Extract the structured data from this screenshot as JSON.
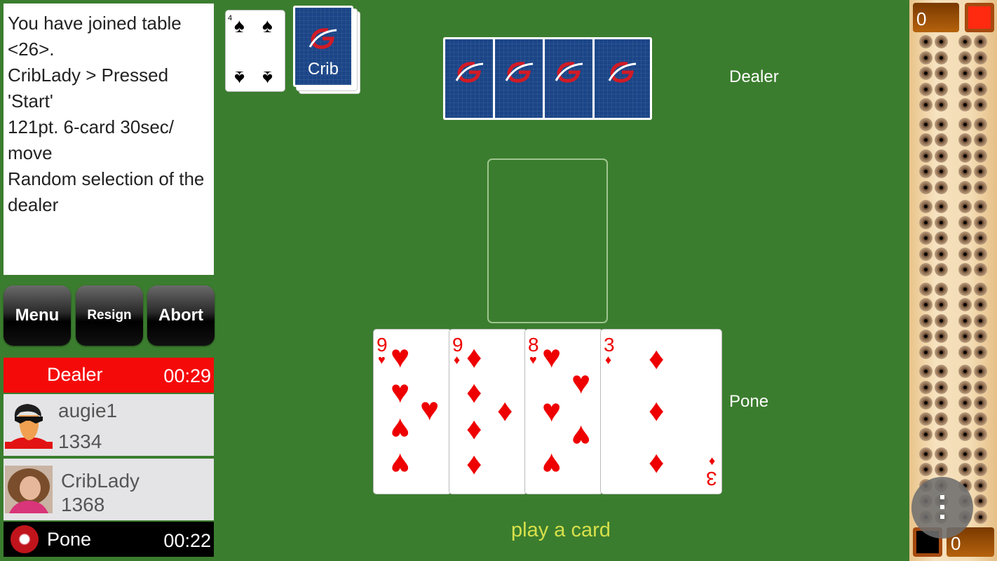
{
  "chat": {
    "messages": [
      "You have joined table <26>.",
      "CribLady >  Pressed 'Start'",
      "121pt. 6-card 30sec/ move",
      "Random selection of the dealer"
    ]
  },
  "buttons": {
    "menu": "Menu",
    "resign": "Resign",
    "abort": "Abort"
  },
  "players": {
    "dealer_bar": {
      "role": "Dealer",
      "timer": "00:29",
      "color": "#f50a0a"
    },
    "opponent": {
      "name": "augie1",
      "rating": "1334",
      "avatar": "sunglasses-avatar"
    },
    "self": {
      "name": "CribLady",
      "rating": "1368",
      "avatar": "photo-avatar"
    },
    "pone_bar": {
      "role": "Pone",
      "timer": "00:22",
      "indicator": "record-dot-icon"
    }
  },
  "table": {
    "starter_card": {
      "rank": "4",
      "suit": "spades"
    },
    "crib_deck_label": "Crib",
    "opponent_hand_count": 4,
    "opponent_label": "Dealer",
    "player_label": "Pone",
    "player_hand": [
      {
        "rank": "9",
        "suit": "hearts"
      },
      {
        "rank": "9",
        "suit": "diamonds"
      },
      {
        "rank": "8",
        "suit": "hearts"
      },
      {
        "rank": "3",
        "suit": "diamonds"
      }
    ],
    "status": "play a card"
  },
  "board": {
    "top_score": "0",
    "bottom_score": "0",
    "top_peg_color": "#ff2a10",
    "bottom_peg_color": "#000000"
  },
  "colors": {
    "felt": "#3b7d2e",
    "card_back": "#1b4587",
    "status_text": "#d7e04a"
  }
}
